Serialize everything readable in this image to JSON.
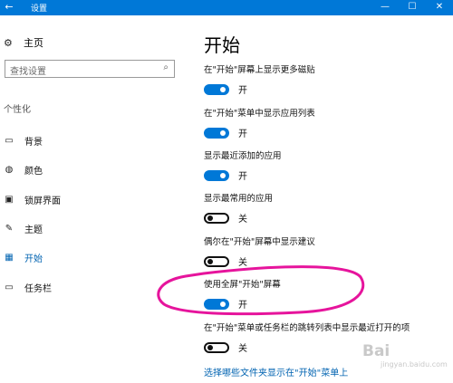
{
  "window": {
    "title": "设置",
    "back_glyph": "←",
    "controls": {
      "minimize": "—",
      "maximize": "☐",
      "close": "✕"
    }
  },
  "sidebar": {
    "home_label": "主页",
    "search_placeholder": "查找设置",
    "section_header": "个性化",
    "items": [
      {
        "label": "背景",
        "icon": "image-icon",
        "glyph": "▭",
        "active": false
      },
      {
        "label": "颜色",
        "icon": "palette-icon",
        "glyph": "◍",
        "active": false
      },
      {
        "label": "锁屏界面",
        "icon": "lockscreen-icon",
        "glyph": "▣",
        "active": false
      },
      {
        "label": "主题",
        "icon": "theme-icon",
        "glyph": "✎",
        "active": false
      },
      {
        "label": "开始",
        "icon": "start-icon",
        "glyph": "▦",
        "active": true
      },
      {
        "label": "任务栏",
        "icon": "taskbar-icon",
        "glyph": "▭",
        "active": false
      }
    ]
  },
  "main": {
    "title": "开始",
    "settings": [
      {
        "label": "在\"开始\"屏幕上显示更多磁贴",
        "state": "开",
        "on": true
      },
      {
        "label": "在\"开始\"菜单中显示应用列表",
        "state": "开",
        "on": true
      },
      {
        "label": "显示最近添加的应用",
        "state": "开",
        "on": true
      },
      {
        "label": "显示最常用的应用",
        "state": "关",
        "on": false
      },
      {
        "label": "偶尔在\"开始\"屏幕中显示建议",
        "state": "关",
        "on": false
      },
      {
        "label": "使用全屏\"开始\"屏幕",
        "state": "开",
        "on": true
      },
      {
        "label": "在\"开始\"菜单或任务栏的跳转列表中显示最近打开的项",
        "state": "关",
        "on": false
      }
    ],
    "link": "选择哪些文件夹显示在\"开始\"菜单上"
  },
  "annotation": {
    "color": "#e6149c"
  },
  "watermark": {
    "text": "Bai",
    "sub": "jingyan.baidu.com"
  },
  "colors": {
    "accent": "#0078d7",
    "link": "#0063b1"
  }
}
